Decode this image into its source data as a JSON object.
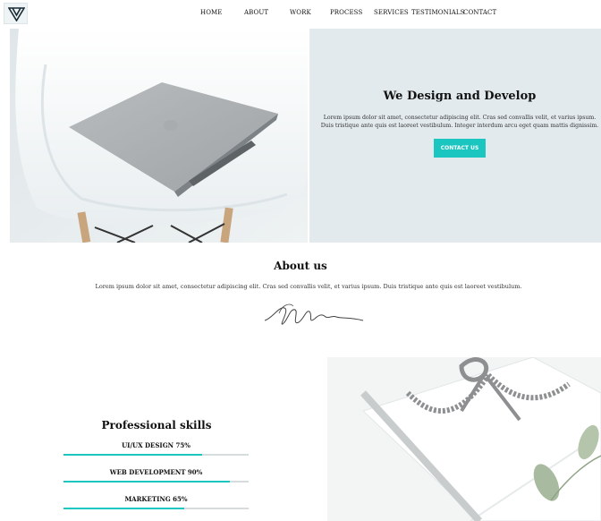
{
  "nav": {
    "items": [
      "HOME",
      "ABOUT",
      "WORK",
      "PROCESS",
      "SERVICES",
      "TESTIMONIALS",
      "CONTACT"
    ]
  },
  "hero": {
    "title": "We Design and Develop",
    "description": "Lorem ipsum dolor sit amet, consectetur adipiscing elit. Cras sed convallis velit, et varius ipsum. Duis tristique ante quis est laoreet vestibulum. Integer interdum arcu eget quam mattis dignissim.",
    "button_label": "CONTACT US"
  },
  "about": {
    "title": "About us",
    "text": "Lorem ipsum dolor sit amet, consectetur adipiscing elit. Cras sed convallis velit, et varius ipsum. Duis tristique ante quis est laoreet vestibulum."
  },
  "skills": {
    "title": "Professional skills",
    "items": [
      {
        "label": "UI/UX DESIGN 75%",
        "percent": 75
      },
      {
        "label": "WEB DEVELOPMENT 90%",
        "percent": 90
      },
      {
        "label": "MARKETING 65%",
        "percent": 65
      }
    ]
  },
  "colors": {
    "accent": "#1bc6c0",
    "hero_bg": "#e2eaed"
  },
  "icons": [
    "logo-icon",
    "signature-icon"
  ]
}
